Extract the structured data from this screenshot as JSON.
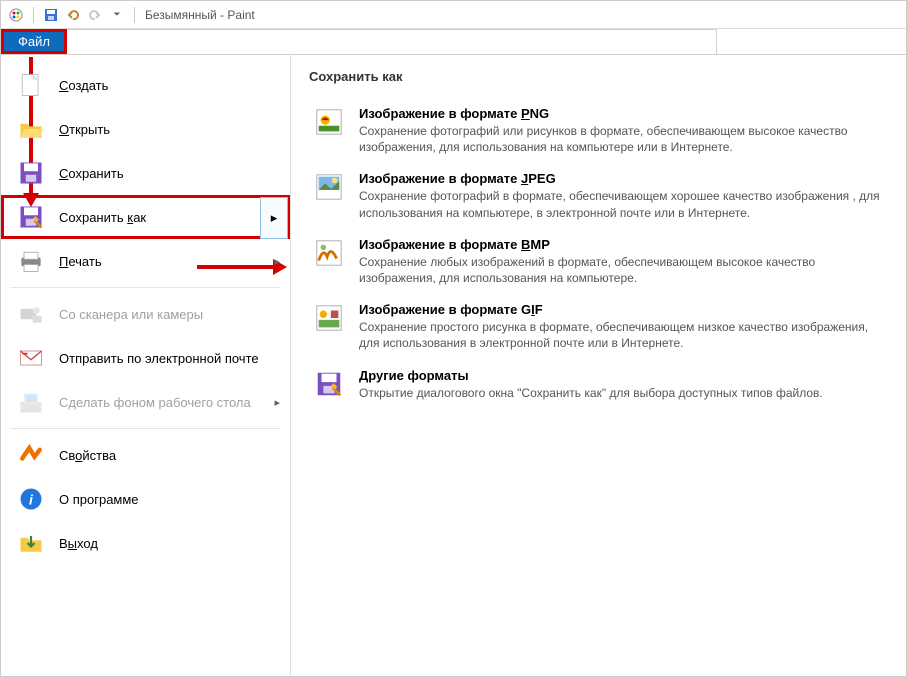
{
  "titlebar": {
    "doc_title": "Безымянный - Paint"
  },
  "ribbon": {
    "file_tab": "Файл"
  },
  "left_menu": {
    "items": [
      {
        "label": "Создать",
        "underline_idx": 0
      },
      {
        "label": "Открыть",
        "underline_idx": 0
      },
      {
        "label": "Сохранить",
        "underline_idx": 0
      },
      {
        "label": "Сохранить как",
        "underline_idx": 10,
        "has_submenu": true,
        "highlighted": true
      },
      {
        "label": "Печать",
        "underline_idx": 0,
        "has_submenu": true
      },
      {
        "label": "Со сканера или камеры",
        "disabled": true
      },
      {
        "label": "Отправить по электронной почте"
      },
      {
        "label": "Сделать фоном рабочего стола",
        "has_submenu": true,
        "disabled": true
      },
      {
        "label": "Свойства",
        "underline_idx": 2
      },
      {
        "label": "О программе"
      },
      {
        "label": "Выход",
        "underline_idx": 1
      }
    ],
    "separators_after": [
      4,
      7
    ]
  },
  "right_panel": {
    "title": "Сохранить как",
    "formats": [
      {
        "title": "Изображение в формате PNG",
        "underline_idx": 22,
        "desc": "Сохранение фотографий или рисунков в формате, обеспечивающем высокое качество изображения, для использования на компьютере или в Интернете."
      },
      {
        "title": "Изображение в формате JPEG",
        "underline_idx": 22,
        "desc": "Сохранение фотографий в формате, обеспечивающем хорошее качество изображения , для использования на компьютере, в электронной почте или в Интернете."
      },
      {
        "title": "Изображение в формате BMP",
        "underline_idx": 22,
        "desc": "Сохранение любых изображений в формате, обеспечивающем высокое качество изображения, для использования на компьютере."
      },
      {
        "title": "Изображение в формате GIF",
        "underline_idx": 23,
        "desc": "Сохранение простого рисунка в формате, обеспечивающем низкое качество изображения, для использования в электронной почте или в Интернете."
      },
      {
        "title": "Другие форматы",
        "underline_idx": 0,
        "desc": "Открытие диалогового окна \"Сохранить как\" для выбора доступных типов файлов."
      }
    ]
  }
}
